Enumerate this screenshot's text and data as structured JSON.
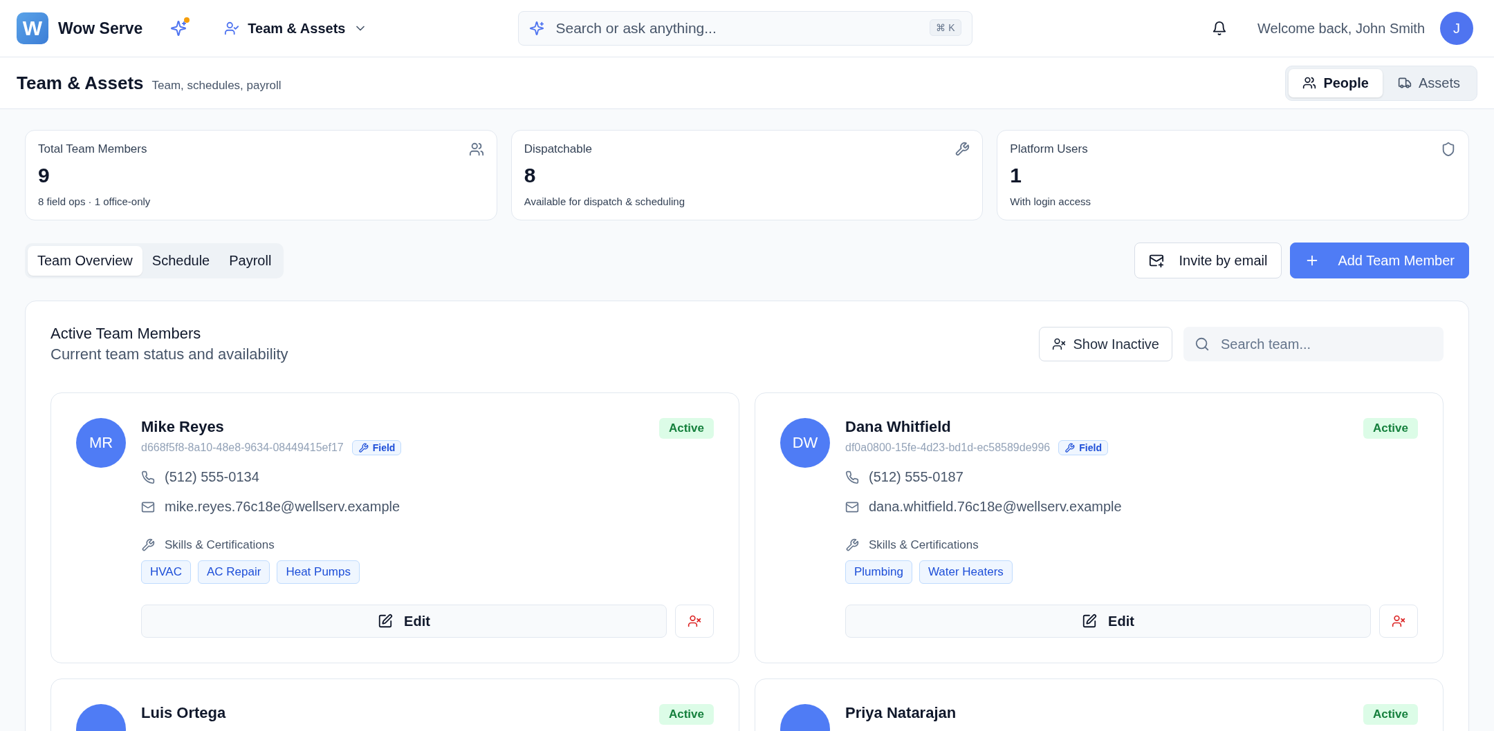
{
  "app": {
    "name": "Wow Serve",
    "logo_letter": "W",
    "ai_notification": true,
    "nav": {
      "label": "Team & Assets"
    },
    "search": {
      "placeholder": "Search or ask anything...",
      "shortcut": "⌘ K"
    },
    "welcome": "Welcome back, John Smith",
    "avatar": "J"
  },
  "page": {
    "title": "Team & Assets",
    "subtitle": "Team, schedules, payroll",
    "views": [
      {
        "label": "People",
        "selected": true
      },
      {
        "label": "Assets",
        "selected": false
      }
    ]
  },
  "stats": [
    {
      "label": "Total Team Members",
      "value": "9",
      "note": "8 field ops · 1 office-only"
    },
    {
      "label": "Dispatchable",
      "value": "8",
      "note": "Available for dispatch & scheduling"
    },
    {
      "label": "Platform Users",
      "value": "1",
      "note": "With login access"
    }
  ],
  "tabs": [
    {
      "label": "Team Overview",
      "selected": true
    },
    {
      "label": "Schedule",
      "selected": false
    },
    {
      "label": "Payroll",
      "selected": false
    }
  ],
  "actions": [
    {
      "label": "Invite by email",
      "kind": "secondary"
    },
    {
      "label": "Add Team Member",
      "kind": "primary"
    }
  ],
  "panel": {
    "title": "Active Team Members",
    "subtitle": "Current team status and availability",
    "show_inactive": "Show Inactive",
    "search": {
      "placeholder": "Search team..."
    }
  },
  "members": [
    {
      "initials": "MR",
      "name": "Mike Reyes",
      "id": "d668f5f8-8a10-48e8-9634-08449415ef17",
      "role": "Field",
      "status": "Active",
      "active": true,
      "phone": "(512) 555-0134",
      "email": "mike.reyes.76c18e@wellserv.example",
      "skills_label": "Skills & Certifications",
      "skills": [
        "HVAC",
        "AC Repair",
        "Heat Pumps"
      ],
      "edit": "Edit"
    },
    {
      "initials": "DW",
      "name": "Dana Whitfield",
      "id": "df0a0800-15fe-4d23-bd1d-ec58589de996",
      "role": "Field",
      "status": "Active",
      "active": true,
      "phone": "(512) 555-0187",
      "email": "dana.whitfield.76c18e@wellserv.example",
      "skills_label": "Skills & Certifications",
      "skills": [
        "Plumbing",
        "Water Heaters"
      ],
      "edit": "Edit"
    },
    {
      "name": "Luis Ortega",
      "status": "Active",
      "active": true
    },
    {
      "name": "Priya Natarajan",
      "status": "Active",
      "active": true
    }
  ]
}
